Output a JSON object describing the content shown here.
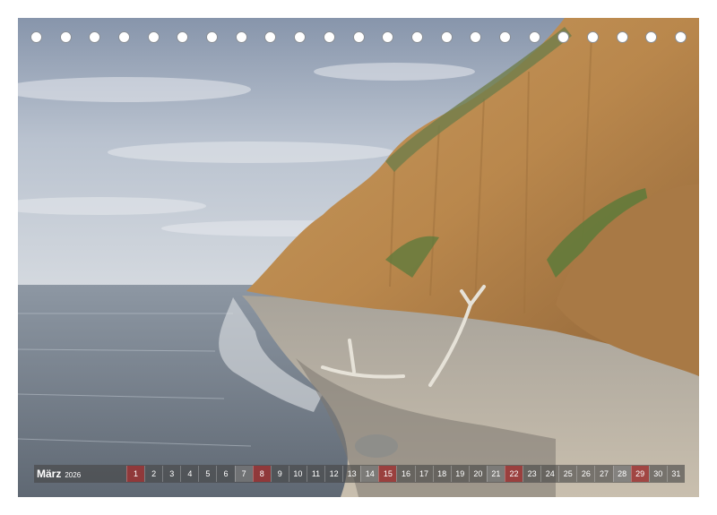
{
  "calendar": {
    "month": "März",
    "year": "2026",
    "days": [
      {
        "num": "1",
        "type": "sun"
      },
      {
        "num": "2",
        "type": ""
      },
      {
        "num": "3",
        "type": ""
      },
      {
        "num": "4",
        "type": ""
      },
      {
        "num": "5",
        "type": ""
      },
      {
        "num": "6",
        "type": ""
      },
      {
        "num": "7",
        "type": "sat"
      },
      {
        "num": "8",
        "type": "sun"
      },
      {
        "num": "9",
        "type": ""
      },
      {
        "num": "10",
        "type": ""
      },
      {
        "num": "11",
        "type": ""
      },
      {
        "num": "12",
        "type": ""
      },
      {
        "num": "13",
        "type": ""
      },
      {
        "num": "14",
        "type": "sat"
      },
      {
        "num": "15",
        "type": "sun"
      },
      {
        "num": "16",
        "type": ""
      },
      {
        "num": "17",
        "type": ""
      },
      {
        "num": "18",
        "type": ""
      },
      {
        "num": "19",
        "type": ""
      },
      {
        "num": "20",
        "type": ""
      },
      {
        "num": "21",
        "type": "sat"
      },
      {
        "num": "22",
        "type": "sun"
      },
      {
        "num": "23",
        "type": ""
      },
      {
        "num": "24",
        "type": ""
      },
      {
        "num": "25",
        "type": ""
      },
      {
        "num": "26",
        "type": ""
      },
      {
        "num": "27",
        "type": ""
      },
      {
        "num": "28",
        "type": "sat"
      },
      {
        "num": "29",
        "type": "sun"
      },
      {
        "num": "30",
        "type": ""
      },
      {
        "num": "31",
        "type": ""
      }
    ]
  },
  "binding_holes": 23
}
